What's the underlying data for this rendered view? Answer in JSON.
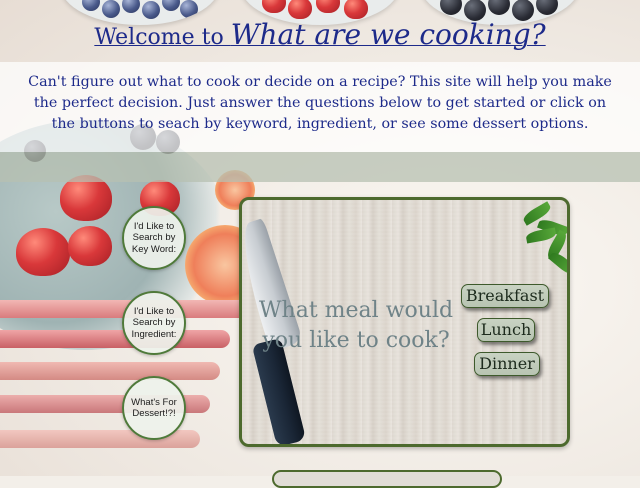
{
  "header": {
    "title_part1": "Welcome to ",
    "title_part2": "What are we cooking?"
  },
  "intro": {
    "text": "Can't figure out what to cook or decide on a recipe? This site will help you make the perfect decision. Just answer the questions below to get started or click on the buttons to seach by keyword, ingredient, or see some dessert options."
  },
  "side_buttons": [
    {
      "label": "I'd Like to Search by Key Word:"
    },
    {
      "label": "I'd Like to Search by Ingredient:"
    },
    {
      "label": "What's For Dessert!?!"
    }
  ],
  "meal_board": {
    "question": "What meal would you like to cook?",
    "options": [
      {
        "label": "Breakfast"
      },
      {
        "label": "Lunch"
      },
      {
        "label": "Dinner"
      }
    ]
  },
  "colors": {
    "heading_blue": "#1d2a8a",
    "border_green": "#4d6a2e",
    "band_grey_green": "#b7c0b2"
  }
}
